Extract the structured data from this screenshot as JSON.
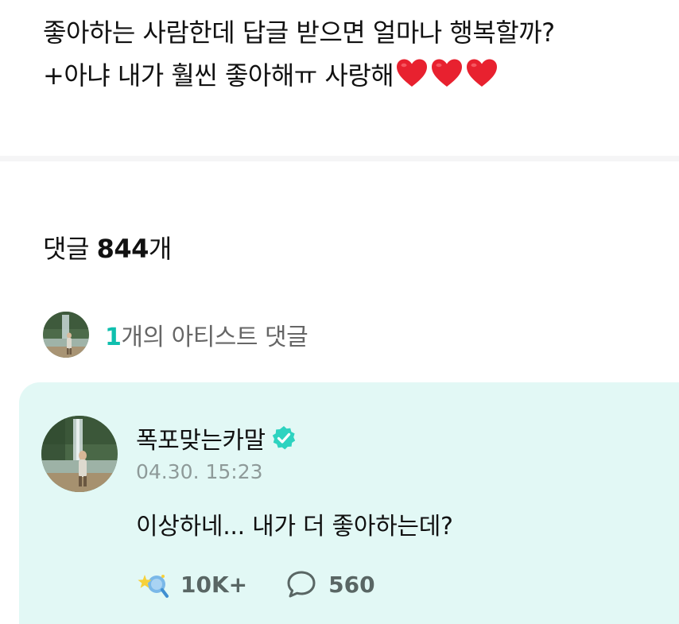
{
  "post": {
    "line1": "좋아하는 사람한데 답글 받으면 얼마나 행복할까?",
    "line2": "+아냐 내가 훨씬 좋아해ㅠ 사랑해",
    "hearts_count": 3,
    "heart_color": "#e8212f"
  },
  "comments": {
    "label": "댓글",
    "count": "844",
    "suffix": "개"
  },
  "artist_comments": {
    "count": "1",
    "label": "개의 아티스트 댓글",
    "accent_color": "#0fbfae"
  },
  "comment": {
    "author": "폭포맞는카말",
    "verified_icon": "verified-badge-icon",
    "timestamp": "04.30. 15:23",
    "text": "이상하네... 내가 더 좋아하는데?",
    "like_count": "10K+",
    "reply_count": "560",
    "card_color": "#e2f8f5"
  }
}
